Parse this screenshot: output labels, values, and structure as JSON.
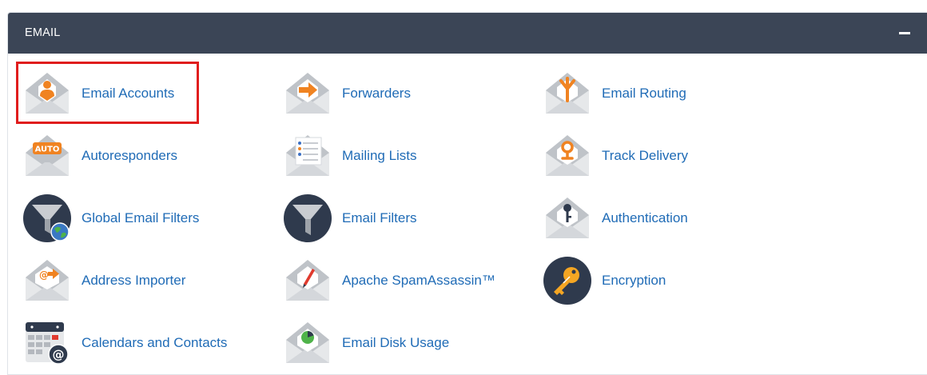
{
  "header": {
    "title": "EMAIL"
  },
  "colors": {
    "header_bg": "#3b4556",
    "link": "#1f6bb6",
    "accent": "#f08321",
    "highlight": "#e01d1d"
  },
  "items": [
    {
      "label": "Email Accounts",
      "icon": "email-accounts-icon"
    },
    {
      "label": "Forwarders",
      "icon": "forwarders-icon"
    },
    {
      "label": "Email Routing",
      "icon": "email-routing-icon"
    },
    {
      "label": "Autoresponders",
      "icon": "autoresponders-icon"
    },
    {
      "label": "Mailing Lists",
      "icon": "mailing-lists-icon"
    },
    {
      "label": "Track Delivery",
      "icon": "track-delivery-icon"
    },
    {
      "label": "Global Email Filters",
      "icon": "global-email-filters-icon"
    },
    {
      "label": "Email Filters",
      "icon": "email-filters-icon"
    },
    {
      "label": "Authentication",
      "icon": "authentication-icon"
    },
    {
      "label": "Address Importer",
      "icon": "address-importer-icon"
    },
    {
      "label": "Apache SpamAssassin™",
      "icon": "spamassassin-icon"
    },
    {
      "label": "Encryption",
      "icon": "encryption-icon"
    },
    {
      "label": "Calendars and Contacts",
      "icon": "calendars-contacts-icon"
    },
    {
      "label": "Email Disk Usage",
      "icon": "email-disk-usage-icon"
    }
  ],
  "badges": {
    "auto": "AUTO",
    "at": "@"
  }
}
